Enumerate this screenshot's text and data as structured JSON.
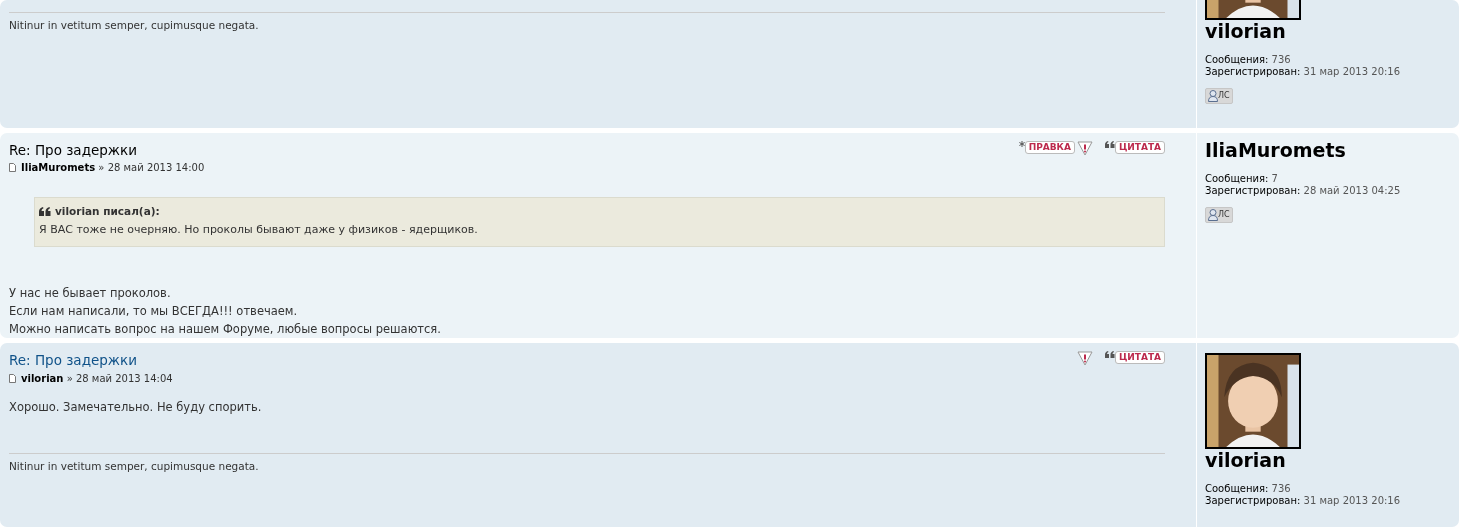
{
  "posts": [
    {
      "signature": "Nitinur in vetitum semper, cupimusque negata.",
      "profile": {
        "avatar": {
          "kind": "picture",
          "cropped": true
        },
        "name": "vilorian",
        "stats": [
          {
            "label": "Сообщения:",
            "value": "736"
          },
          {
            "label": "Зарегистрирован:",
            "value": "31 мар 2013 20:16"
          }
        ],
        "pm": "ЛС"
      }
    },
    {
      "title": "Re: Про задержки",
      "title_is_link": false,
      "author": "IliaMuromets",
      "date": "» 28 май 2013 14:00",
      "buttons": [
        {
          "kind": "edit",
          "label": "ПРАВКА"
        },
        {
          "kind": "report"
        },
        {
          "kind": "quote",
          "label": "ЦИТАТА"
        }
      ],
      "quote": {
        "cite": "vilorian писал(а):",
        "text": "Я ВАС тоже не очерняю. Но проколы бывают даже у физиков - ядерщиков."
      },
      "body": [
        "У нас не бывает проколов.",
        "Если нам написали, то мы ВСЕГДА!!! отвечаем.",
        "Можно написать вопрос на нашем Форуме, любые вопросы решаются."
      ],
      "profile": {
        "name": "IliaMuromets",
        "stats": [
          {
            "label": "Сообщения:",
            "value": "7"
          },
          {
            "label": "Зарегистрирован:",
            "value": "28 май 2013 04:25"
          }
        ],
        "pm": "ЛС"
      }
    },
    {
      "title": "Re: Про задержки",
      "title_is_link": true,
      "author": "vilorian",
      "date": "» 28 май 2013 14:04",
      "buttons": [
        {
          "kind": "report"
        },
        {
          "kind": "quote",
          "label": "ЦИТАТА"
        }
      ],
      "body": [
        "Хорошо. Замечательно. Не буду спорить."
      ],
      "signature": "Nitinur in vetitum semper, cupimusque negata.",
      "profile": {
        "avatar": {
          "kind": "picture",
          "cropped": false
        },
        "name": "vilorian",
        "stats": [
          {
            "label": "Сообщения:",
            "value": "736"
          },
          {
            "label": "Зарегистрирован:",
            "value": "31 мар 2013 20:16"
          }
        ]
      }
    }
  ]
}
